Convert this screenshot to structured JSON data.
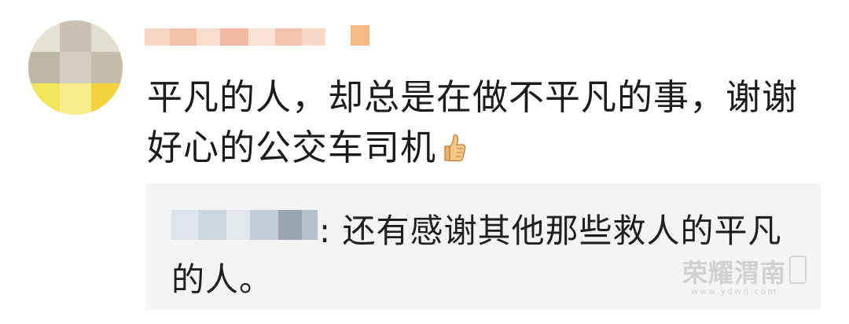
{
  "comment": {
    "text": "平凡的人，却总是在做不平凡的事，谢谢好心的公交车司机",
    "emoji_icon": "thumbs-up-icon"
  },
  "reply": {
    "text": ": 还有感谢其他那些救人的平凡的人。"
  },
  "watermark": {
    "main": "荣耀渭南",
    "url": "www.ydwn.com"
  },
  "colors": {
    "background": "#ffffff",
    "reply_background": "#f4f4f4",
    "text": "#1b1b1b",
    "watermark": "#b4b4b4"
  }
}
